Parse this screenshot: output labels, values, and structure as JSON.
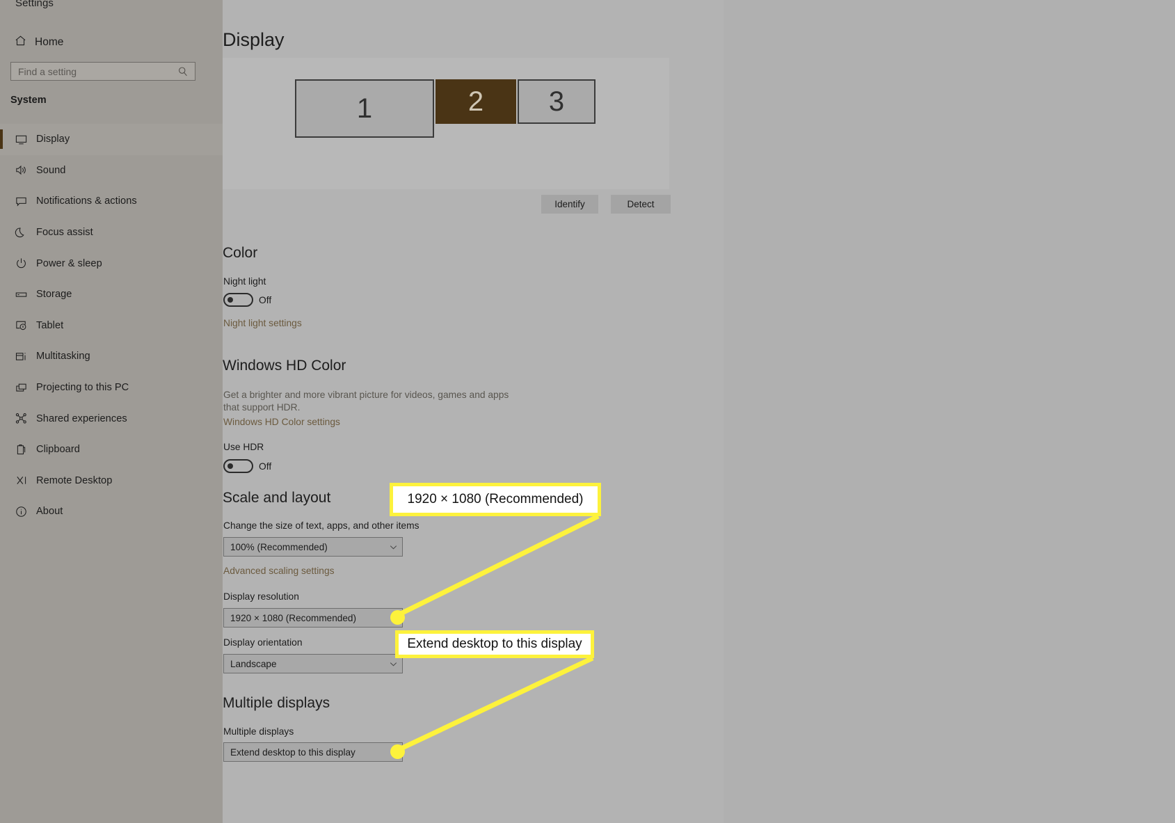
{
  "window": {
    "title": "Settings"
  },
  "sidebar": {
    "home_label": "Home",
    "home_icon": "home-icon",
    "search": {
      "placeholder": "Find a setting",
      "value": "",
      "icon": "search-icon"
    },
    "group_heading": "System",
    "items": [
      {
        "label": "Display",
        "icon": "monitor-icon",
        "selected": true
      },
      {
        "label": "Sound",
        "icon": "speaker-icon",
        "selected": false
      },
      {
        "label": "Notifications & actions",
        "icon": "notification-icon",
        "selected": false
      },
      {
        "label": "Focus assist",
        "icon": "moon-icon",
        "selected": false
      },
      {
        "label": "Power & sleep",
        "icon": "power-icon",
        "selected": false
      },
      {
        "label": "Storage",
        "icon": "drive-icon",
        "selected": false
      },
      {
        "label": "Tablet",
        "icon": "tablet-icon",
        "selected": false
      },
      {
        "label": "Multitasking",
        "icon": "multitasking-icon",
        "selected": false
      },
      {
        "label": "Projecting to this PC",
        "icon": "project-screen-icon",
        "selected": false
      },
      {
        "label": "Shared experiences",
        "icon": "share-nodes-icon",
        "selected": false
      },
      {
        "label": "Clipboard",
        "icon": "clipboard-icon",
        "selected": false
      },
      {
        "label": "Remote Desktop",
        "icon": "remote-desktop-icon",
        "selected": false
      },
      {
        "label": "About",
        "icon": "info-icon",
        "selected": false
      }
    ]
  },
  "main": {
    "page_title": "Display",
    "monitors": [
      {
        "number": "1",
        "selected": false
      },
      {
        "number": "2",
        "selected": true
      },
      {
        "number": "3",
        "selected": false
      }
    ],
    "identify_label": "Identify",
    "detect_label": "Detect",
    "color": {
      "heading": "Color",
      "night_light_label": "Night light",
      "night_light_state": "Off",
      "night_light_settings_link": "Night light settings"
    },
    "hd_color": {
      "heading": "Windows HD Color",
      "description": "Get a brighter and more vibrant picture for videos, games and apps that support HDR.",
      "settings_link": "Windows HD Color settings",
      "use_hdr_label": "Use HDR",
      "use_hdr_state": "Off"
    },
    "scale_layout": {
      "heading": "Scale and layout",
      "scale_label": "Change the size of text, apps, and other items",
      "scale_value": "100% (Recommended)",
      "advanced_link": "Advanced scaling settings",
      "resolution_label": "Display resolution",
      "resolution_value": "1920 × 1080 (Recommended)",
      "orientation_label": "Display orientation",
      "orientation_value": "Landscape"
    },
    "multiple_displays": {
      "heading": "Multiple displays",
      "field_label": "Multiple displays",
      "value": "Extend desktop to this display"
    }
  },
  "annotations": {
    "highlight_color": "#fdf23c",
    "callouts": [
      {
        "text": "1920 × 1080 (Recommended)"
      },
      {
        "text": "Extend desktop to this display"
      }
    ]
  }
}
